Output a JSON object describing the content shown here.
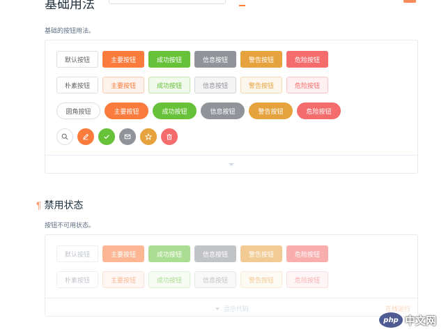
{
  "top": {
    "cut_title": "基础用法"
  },
  "basic": {
    "desc": "基础的按钮用法。",
    "rows": [
      [
        "默认按钮",
        "主要按钮",
        "成功按钮",
        "信息按钮",
        "警告按钮",
        "危险按钮"
      ],
      [
        "朴素按钮",
        "主要按钮",
        "成功按钮",
        "信息按钮",
        "警告按钮",
        "危险按钮"
      ],
      [
        "圆角按钮",
        "主要按钮",
        "成功按钮",
        "信息按钮",
        "警告按钮",
        "危险按钮"
      ]
    ],
    "icon_buttons": [
      "search-icon",
      "edit-icon",
      "check-icon",
      "message-icon",
      "star-icon",
      "delete-icon"
    ]
  },
  "disabled": {
    "title": "禁用状态",
    "pilcrow": "¶",
    "desc": "按钮不可用状态。",
    "rows": [
      [
        "默认按钮",
        "主要按钮",
        "成功按钮",
        "信息按钮",
        "警告按钮",
        "危险按钮"
      ],
      [
        "朴素按钮",
        "主要按钮",
        "成功按钮",
        "信息按钮",
        "警告按钮",
        "危险按钮"
      ]
    ],
    "show_code": "显示代码",
    "online_run": "在线运行"
  },
  "watermark": {
    "logo": "php",
    "text": "中文网"
  },
  "colors": {
    "primary": "#fb7b3c",
    "success": "#67c23a",
    "info": "#909399",
    "warning": "#e6a23c",
    "danger": "#f56c6c"
  }
}
